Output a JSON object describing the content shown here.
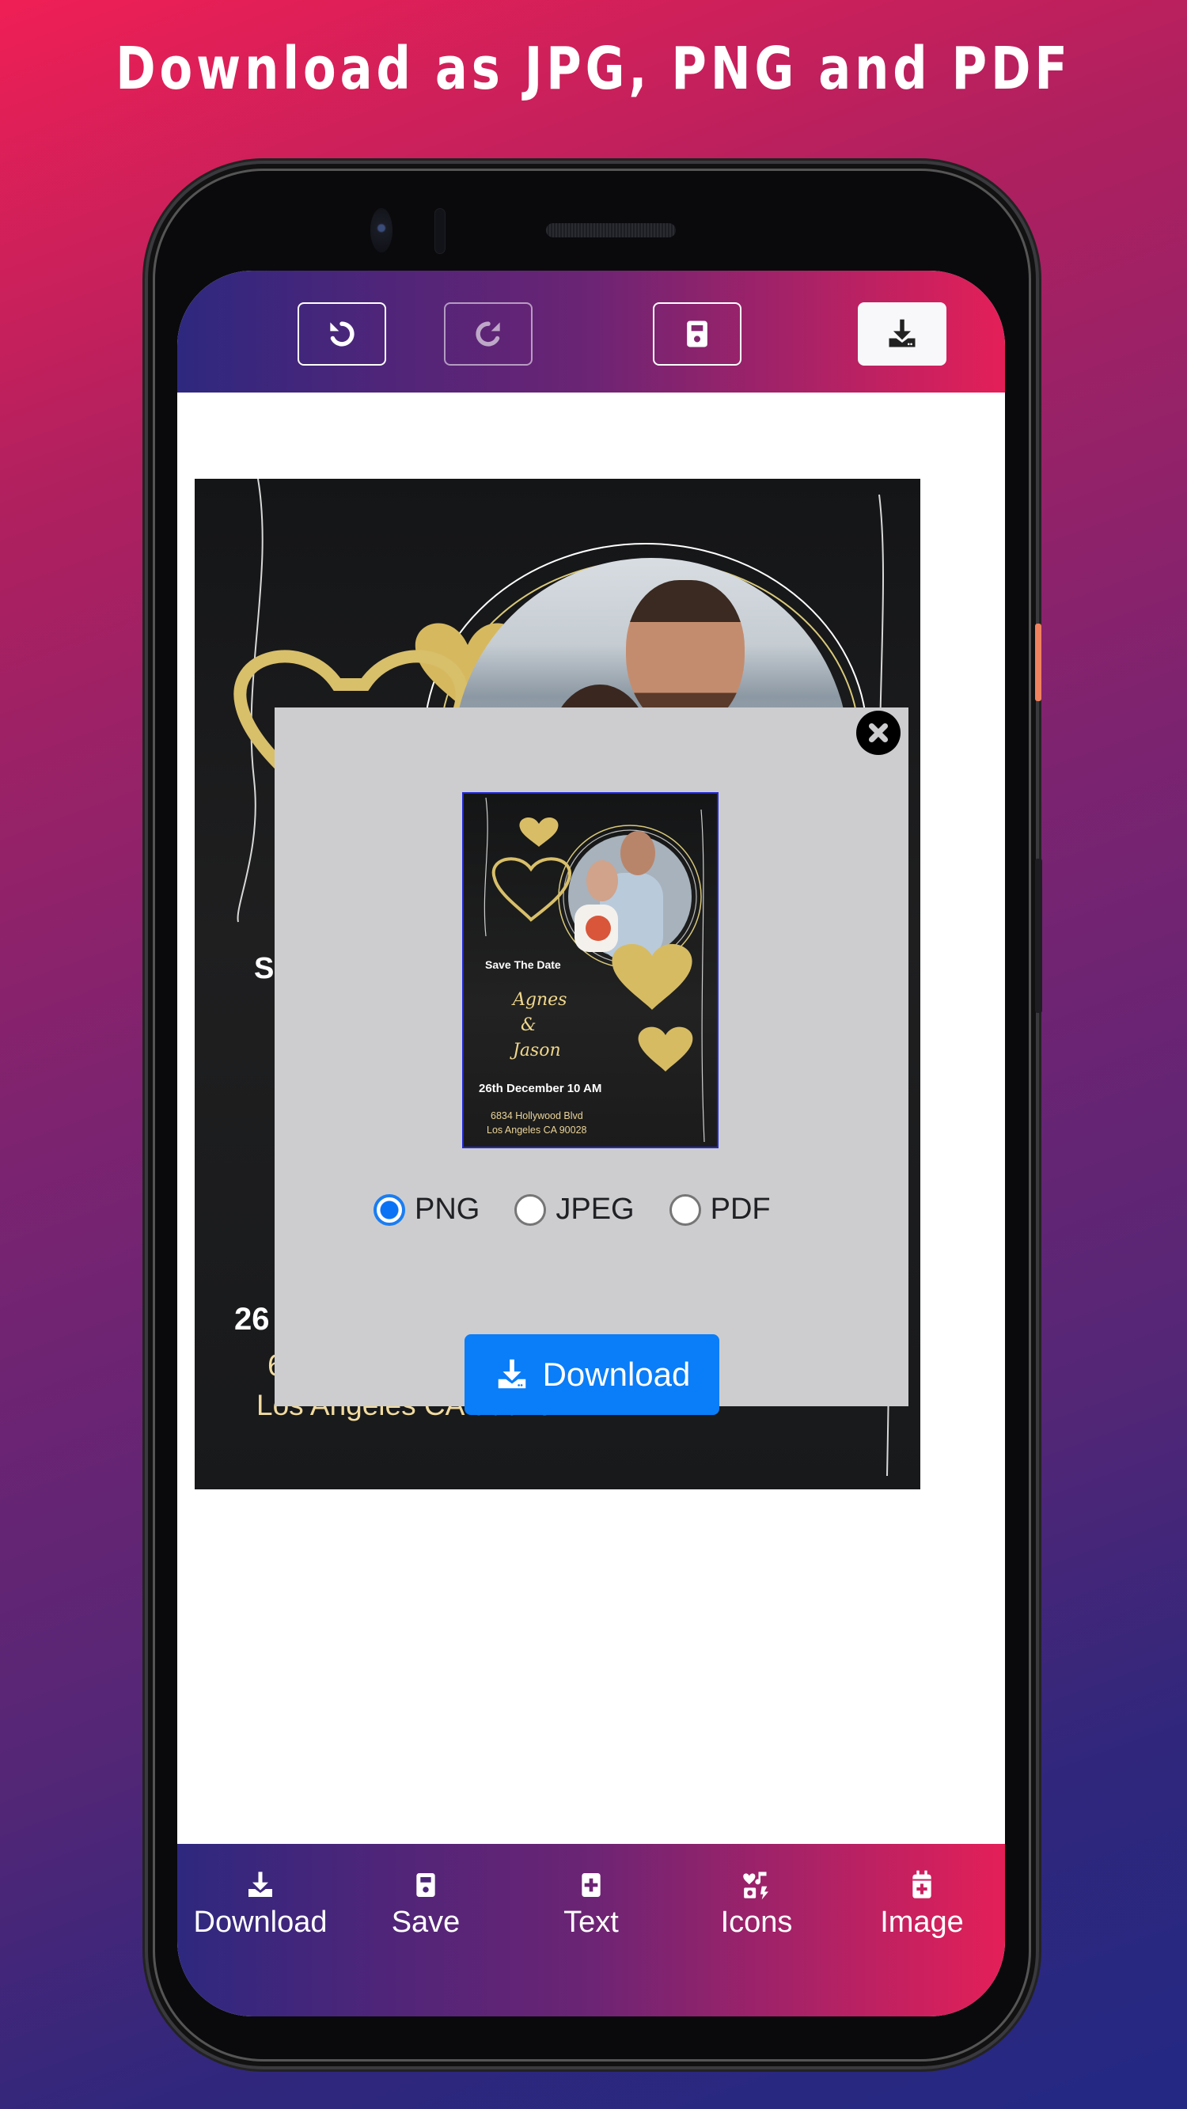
{
  "promo": {
    "title": "Download as JPG, PNG and PDF"
  },
  "toolbar": {
    "undo_icon": "undo-icon",
    "redo_icon": "redo-icon",
    "save_icon": "floppy-disk-icon",
    "download_icon": "download-icon",
    "redo_disabled": true
  },
  "canvas": {
    "save_the_date": "Save The Date",
    "bride": "Agnes",
    "ampersand": "&",
    "groom": "Jason",
    "date_time": "26th December 10 AM",
    "address_line1": "6834 Hollywood Blvd",
    "address_line2": "Los Angeles CA 90028",
    "visible_partial": {
      "save_fragment": "S",
      "date_fragment": "26",
      "addr1_fragment": "6"
    }
  },
  "modal": {
    "close_icon": "close-circle-icon",
    "preview": {
      "save_the_date": "Save The Date",
      "bride": "Agnes",
      "ampersand": "&",
      "groom": "Jason",
      "date_time": "26th December 10 AM",
      "address_line1": "6834 Hollywood Blvd",
      "address_line2": "Los Angeles CA 90028"
    },
    "formats": [
      {
        "label": "PNG",
        "checked": true
      },
      {
        "label": "JPEG",
        "checked": false
      },
      {
        "label": "PDF",
        "checked": false
      }
    ],
    "download_label": "Download",
    "colors": {
      "button": "#0A7DF8",
      "radio_selected": "#1A7DF2",
      "background": "#CDCDD0"
    }
  },
  "bottom_nav": {
    "items": [
      {
        "label": "Download",
        "icon": "download-icon"
      },
      {
        "label": "Save",
        "icon": "floppy-disk-icon"
      },
      {
        "label": "Text",
        "icon": "plus-square-icon"
      },
      {
        "label": "Icons",
        "icon": "icons-collection-icon"
      },
      {
        "label": "Image",
        "icon": "calendar-plus-icon"
      }
    ]
  },
  "theme": {
    "gradient_start": "#2E287F",
    "gradient_end": "#E41F58"
  }
}
